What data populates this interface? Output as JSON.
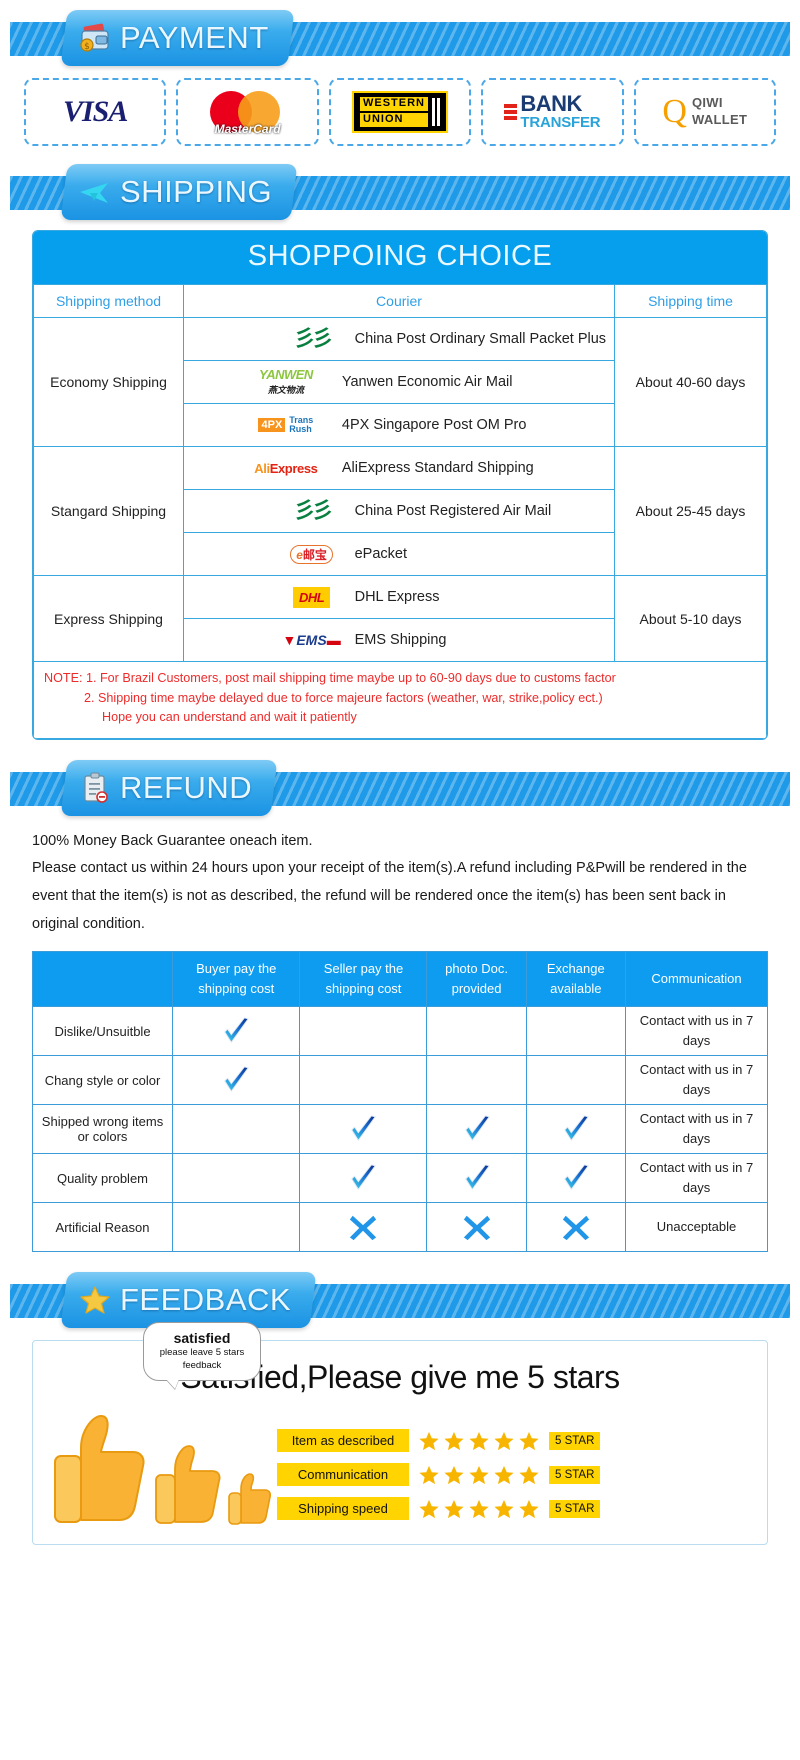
{
  "sections": {
    "payment": {
      "title": "PAYMENT",
      "icon": "wallet-icon"
    },
    "shipping": {
      "title": "SHIPPING",
      "icon": "airplane-icon"
    },
    "refund": {
      "title": "REFUND",
      "icon": "clipboard-icon"
    },
    "feedback": {
      "title": "FEEDBACK",
      "icon": "star-icon"
    }
  },
  "payment": {
    "methods": [
      {
        "name": "visa",
        "label": "VISA"
      },
      {
        "name": "mastercard",
        "label": "MasterCard"
      },
      {
        "name": "western-union",
        "line1": "WESTERN",
        "line2": "UNION"
      },
      {
        "name": "bank-transfer",
        "line1": "BANK",
        "line2": "TRANSFER"
      },
      {
        "name": "qiwi-wallet",
        "mark": "Q",
        "line1": "QIWI",
        "line2": "WALLET"
      }
    ]
  },
  "shipping": {
    "table_title": "SHOPPOING CHOICE",
    "columns": [
      "Shipping method",
      "Courier",
      "Shipping time"
    ],
    "groups": [
      {
        "method": "Economy Shipping",
        "time": "About 40-60 days",
        "couriers": [
          {
            "logo": "china-post-logo",
            "label": "China Post Ordinary Small Packet Plus"
          },
          {
            "logo": "yanwen-logo",
            "label": "Yanwen Economic Air Mail"
          },
          {
            "logo": "4px-transrush-logo",
            "label": "4PX Singapore Post OM Pro"
          }
        ]
      },
      {
        "method": "Stangard Shipping",
        "time": "About 25-45 days",
        "couriers": [
          {
            "logo": "aliexpress-logo",
            "label": "AliExpress Standard Shipping"
          },
          {
            "logo": "china-post-logo",
            "label": "China Post Registered Air Mail"
          },
          {
            "logo": "epacket-logo",
            "label": "ePacket"
          }
        ]
      },
      {
        "method": "Express Shipping",
        "time": "About 5-10 days",
        "couriers": [
          {
            "logo": "dhl-logo",
            "label": "DHL Express"
          },
          {
            "logo": "ems-logo",
            "label": "EMS Shipping"
          }
        ]
      }
    ],
    "notes": [
      "NOTE: 1. For Brazil Customers, post mail shipping time maybe up to 60-90 days due to customs factor",
      "2. Shipping time maybe delayed due to force majeure factors (weather, war, strike,policy ect.)",
      "Hope you can understand and wait it patiently"
    ]
  },
  "refund": {
    "paragraphs": [
      "100% Money Back Guarantee oneach item.",
      "Please contact us within 24 hours upon your receipt of the item(s).A refund including P&Pwill be rendered in the event that the item(s) is not as described, the refund will be rendered once the item(s) has been sent back in original condition."
    ],
    "columns": [
      "",
      "Buyer pay the shipping cost",
      "Seller pay the shipping cost",
      "photo Doc. provided",
      "Exchange available",
      "Communication"
    ],
    "rows": [
      {
        "label": "Dislike/Unsuitble",
        "buyer": "check",
        "seller": "",
        "photo": "",
        "exchange": "",
        "communication": "Contact with us in 7 days"
      },
      {
        "label": "Chang style or color",
        "buyer": "check",
        "seller": "",
        "photo": "",
        "exchange": "",
        "communication": "Contact with us in 7 days"
      },
      {
        "label": "Shipped wrong items or colors",
        "buyer": "",
        "seller": "check",
        "photo": "check",
        "exchange": "check",
        "communication": "Contact with us in 7 days"
      },
      {
        "label": "Quality problem",
        "buyer": "",
        "seller": "check",
        "photo": "check",
        "exchange": "check",
        "communication": "Contact with us in 7 days"
      },
      {
        "label": "Artificial Reason",
        "buyer": "",
        "seller": "cross",
        "photo": "cross",
        "exchange": "cross",
        "communication": "Unacceptable"
      }
    ]
  },
  "feedback": {
    "headline": "Satisfied,Please give me 5 stars",
    "bubble_line1": "satisfied",
    "bubble_line2": "please leave 5 stars feedback",
    "rows": [
      {
        "tag": "Item as described",
        "stars": 5,
        "badge": "5 STAR"
      },
      {
        "tag": "Communication",
        "stars": 5,
        "badge": "5 STAR"
      },
      {
        "tag": "Shipping speed",
        "stars": 5,
        "badge": "5 STAR"
      }
    ]
  },
  "colors": {
    "banner_blue": "#1e9ae8",
    "table_header_blue": "#059fee",
    "note_red": "#ee2b2b",
    "tag_yellow": "#ffd400",
    "star_gold": "#f7b500"
  }
}
